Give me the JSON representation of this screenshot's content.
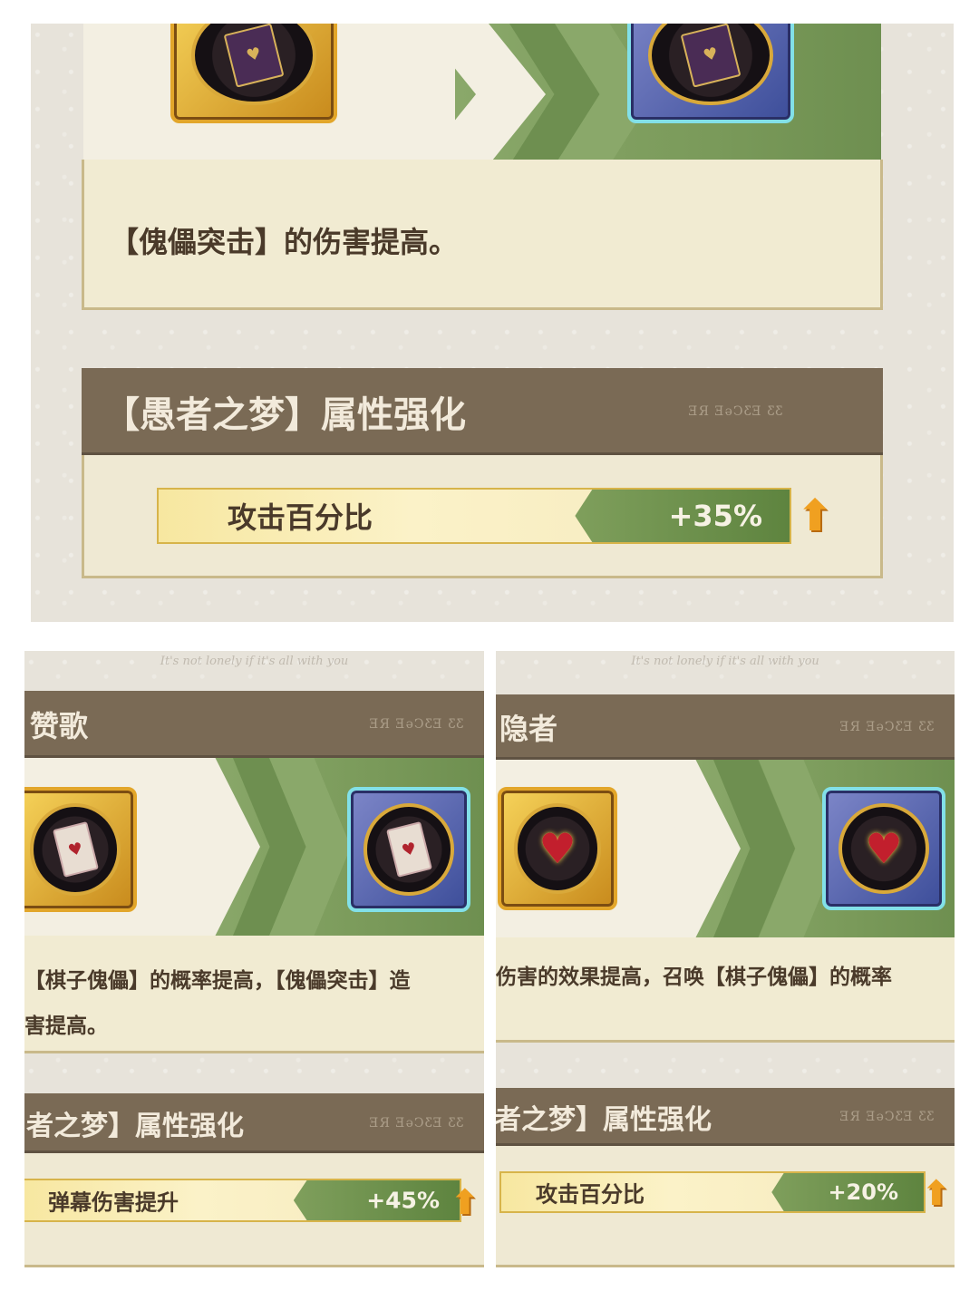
{
  "panels": {
    "top": {
      "description": "【傀儡突击】的伤害提高。",
      "section_title": "【愚者之梦】属性强化",
      "header_deco": "ƎЯ ƎǝϽƸƎ ƸƸ",
      "stat": {
        "label": "攻击百分比",
        "value": "+35%"
      }
    },
    "bottom_left": {
      "tagline": "It's not lonely if it's all with you",
      "header_title": "赞歌",
      "header_deco": "ƎЯ ƎǝϽƸƎ ƸƸ",
      "description_line1": "【棋子傀儡】的概率提高，【傀儡突击】造",
      "description_line2": "害提高。",
      "section_title": "者之梦】属性强化",
      "section_deco": "ƎЯ ƎǝϽƸƎ ƸƸ",
      "stat": {
        "label": "弹幕伤害提升",
        "value": "+45%"
      }
    },
    "bottom_right": {
      "tagline": "It's not lonely if it's all with you",
      "header_title": "隐者",
      "header_deco": "ƎЯ ƎǝϽƸƎ ƸƸ",
      "description_line1": "伤害的效果提高，召唤【棋子傀儡】的概率",
      "section_title": "者之梦】属性强化",
      "section_deco": "ƎЯ ƎǝϽƸƎ ƸƸ",
      "stat": {
        "label": "攻击百分比",
        "value": "+20%"
      }
    }
  },
  "icons": {
    "card": "♥",
    "heart": "♥",
    "arrow": "⬆"
  },
  "colors": {
    "header_bg": "#7a6a55",
    "green": "#7a9a5a",
    "gold": "#e2a62a",
    "blue_frame": "#82e0e8"
  }
}
